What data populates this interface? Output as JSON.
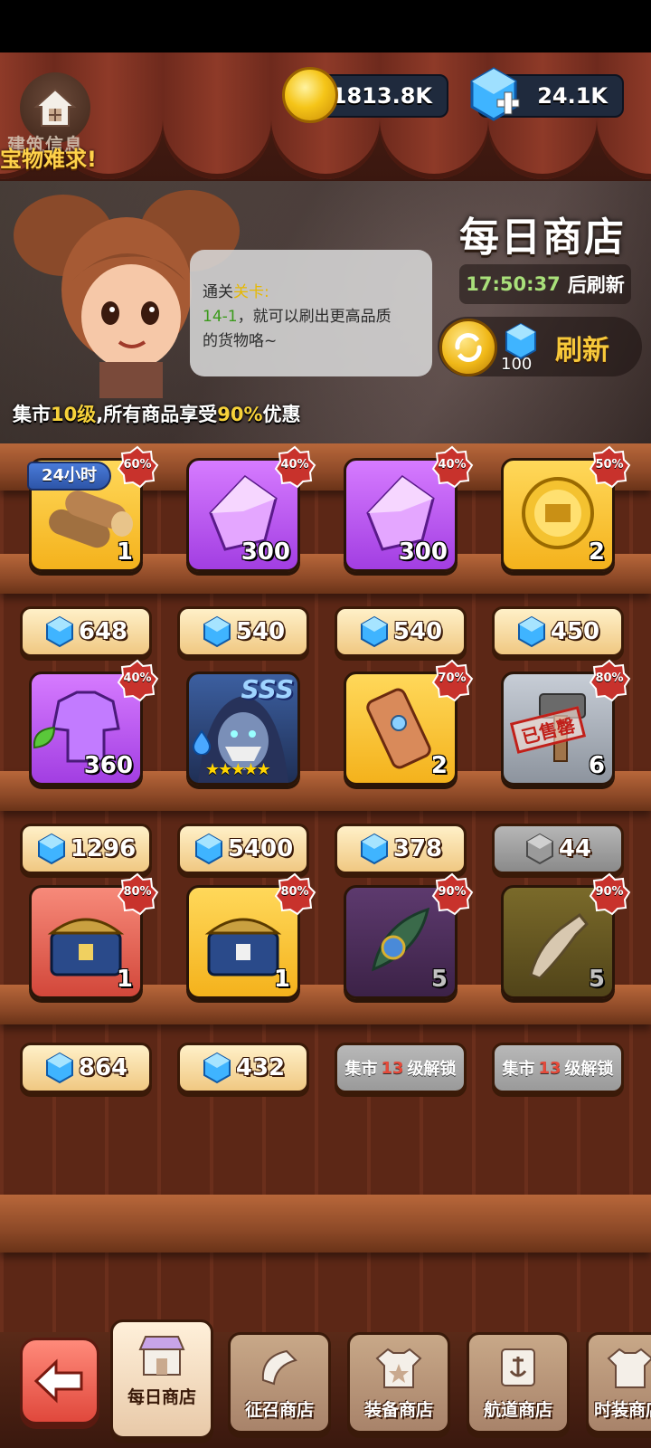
{
  "header": {
    "build_info": "建筑信息",
    "ticker": "宝物难求!",
    "coins": "1813.8K",
    "gems": "24.1K"
  },
  "banner": {
    "title": "每日商店",
    "timer": "17:50:37",
    "timer_suffix": "后刷新",
    "speech_line1_prefix": "通关",
    "speech_line1_highlight": "关卡:",
    "speech_line2_highlight": "14-1",
    "speech_line2_rest": "，就可以刷出更高品质",
    "speech_line3": "的货物咯~",
    "discount_prefix": "集市",
    "discount_level": "10级",
    "discount_mid": ",所有商品享受",
    "discount_pct": "90%",
    "discount_suffix": "优惠",
    "refresh_cost": "100",
    "refresh_label": "刷新"
  },
  "tag_24h": "24小时",
  "items": [
    {
      "name": "wood",
      "qty": "1",
      "badge": "60%",
      "price": "648"
    },
    {
      "name": "purple-crystal",
      "qty": "300",
      "badge": "40%",
      "price": "540"
    },
    {
      "name": "purple-crystal",
      "qty": "300",
      "badge": "40%",
      "price": "540"
    },
    {
      "name": "gold-medal",
      "qty": "2",
      "badge": "50%",
      "price": "450"
    },
    {
      "name": "purple-armor",
      "qty": "360",
      "badge": "40%",
      "price": "1296"
    },
    {
      "name": "hero-card",
      "qty": "",
      "badge": "",
      "price": "5400",
      "rank": "SSS",
      "stars": "★★★★★"
    },
    {
      "name": "scroll",
      "qty": "2",
      "badge": "70%",
      "price": "378"
    },
    {
      "name": "hammer",
      "qty": "6",
      "badge": "80%",
      "price": "44",
      "sold": "已售罄"
    },
    {
      "name": "red-chest",
      "qty": "1",
      "badge": "80%",
      "price": "864"
    },
    {
      "name": "gold-chest",
      "qty": "1",
      "badge": "80%",
      "price": "432"
    },
    {
      "name": "amulet",
      "qty": "5",
      "badge": "90%",
      "locked_prefix": "集市",
      "locked_level": "13",
      "locked_suffix": "级解锁"
    },
    {
      "name": "bone-horn",
      "qty": "5",
      "badge": "90%",
      "locked_prefix": "集市",
      "locked_level": "13",
      "locked_suffix": "级解锁"
    }
  ],
  "nav": {
    "tab1": "每日商店",
    "tab2": "征召商店",
    "tab3": "装备商店",
    "tab4": "航道商店",
    "tab5": "时装商店"
  },
  "colors": {
    "accent_gold": "#f7c83a",
    "badge_red": "#c8322c",
    "gem_blue": "#3fb4ff"
  }
}
